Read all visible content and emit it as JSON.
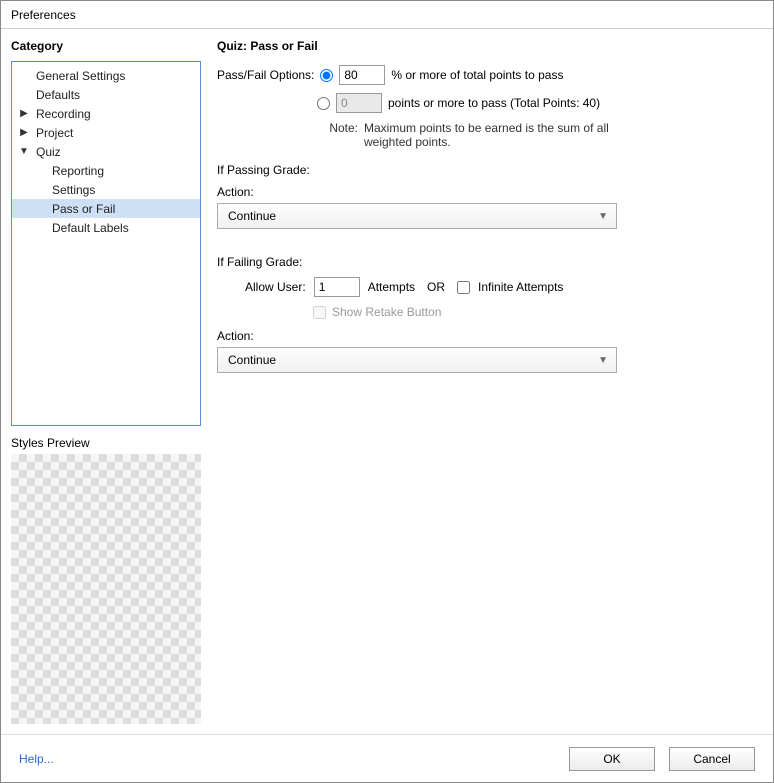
{
  "title": "Preferences",
  "left": {
    "category_label": "Category",
    "items": {
      "general": "General Settings",
      "defaults": "Defaults",
      "recording": "Recording",
      "project": "Project",
      "quiz": "Quiz",
      "reporting": "Reporting",
      "settings": "Settings",
      "pass_or_fail": "Pass or Fail",
      "default_labels": "Default Labels"
    },
    "styles_preview_label": "Styles Preview"
  },
  "panel": {
    "title": "Quiz: Pass or Fail",
    "passfail_label": "Pass/Fail Options:",
    "percent_value": "80",
    "percent_suffix": "% or more of total points to pass",
    "points_value": "0",
    "points_suffix": "points or more to pass (Total Points: 40)",
    "note_label": "Note:",
    "note_text": "Maximum points to be earned is the sum of all weighted points.",
    "passing_label": "If Passing Grade:",
    "action_label": "Action:",
    "passing_action_value": "Continue",
    "failing_label": "If Failing Grade:",
    "allow_user_label": "Allow User:",
    "attempts_value": "1",
    "attempts_label": "Attempts",
    "or_label": "OR",
    "infinite_label": "Infinite Attempts",
    "retake_label": "Show Retake Button",
    "failing_action_value": "Continue"
  },
  "footer": {
    "help": "Help...",
    "ok": "OK",
    "cancel": "Cancel"
  }
}
